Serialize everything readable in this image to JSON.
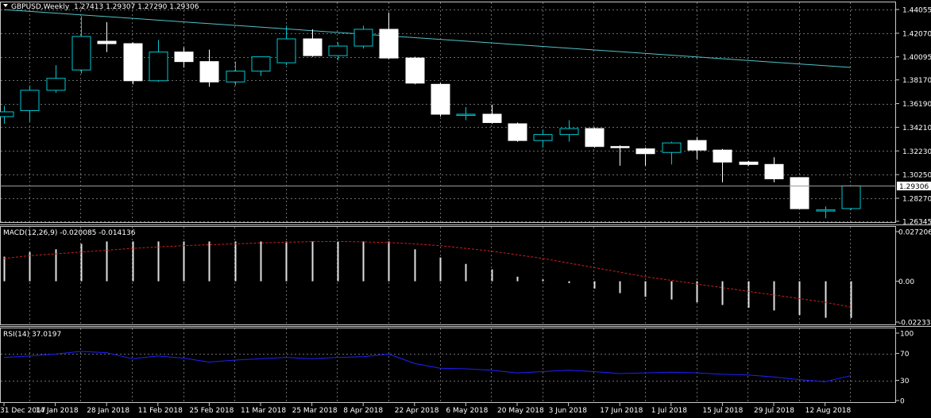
{
  "colors": {
    "background": "#000000",
    "bull_border": "#00c8d0",
    "bear_fill": "#ffffff",
    "trend": "#4fc3c8",
    "macd_signal": "#cc1f1f",
    "rsi": "#2020ff",
    "grid": "#6b6b6b",
    "text": "#ffffff",
    "tag_bg": "#ffffff",
    "tag_text": "#000000"
  },
  "price_panel": {
    "symbol": "GBPUSD,Weekly",
    "ohlc": "1.27413 1.29307 1.27290 1.29306",
    "current_price": "1.29306",
    "axis_labels": [
      "1.44055",
      "1.42070",
      "1.40095",
      "1.38170",
      "1.36190",
      "1.34210",
      "1.32230",
      "1.30250",
      "1.28270",
      "1.26345"
    ]
  },
  "macd_panel": {
    "label": "MACD(12,26,9) -0.020085 -0.014136",
    "axis_labels": [
      "0.027206",
      "0.00",
      "-0.022337"
    ]
  },
  "rsi_panel": {
    "label": "RSI(14) 37.0197",
    "axis_labels": [
      "100",
      "70",
      "30",
      "0"
    ]
  },
  "time_axis": [
    "31 Dec 2017",
    "14 Jan 2018",
    "28 Jan 2018",
    "11 Feb 2018",
    "25 Feb 2018",
    "11 Mar 2018",
    "25 Mar 2018",
    "8 Apr 2018",
    "22 Apr 2018",
    "6 May 2018",
    "20 May 2018",
    "3 Jun 2018",
    "17 Jun 2018",
    "1 Jul 2018",
    "15 Jul 2018",
    "29 Jul 2018",
    "12 Aug 2018"
  ],
  "chart_data": {
    "type": "candlestick",
    "title": "GBPUSD,Weekly",
    "ylim": [
      1.26345,
      1.44055
    ],
    "candles": [
      {
        "o": 1.351,
        "h": 1.36,
        "l": 1.345,
        "c": 1.355
      },
      {
        "o": 1.356,
        "h": 1.377,
        "l": 1.347,
        "c": 1.373
      },
      {
        "o": 1.373,
        "h": 1.394,
        "l": 1.371,
        "c": 1.383
      },
      {
        "o": 1.39,
        "h": 1.435,
        "l": 1.387,
        "c": 1.418
      },
      {
        "o": 1.414,
        "h": 1.43,
        "l": 1.405,
        "c": 1.412
      },
      {
        "o": 1.412,
        "h": 1.413,
        "l": 1.378,
        "c": 1.381
      },
      {
        "o": 1.381,
        "h": 1.415,
        "l": 1.38,
        "c": 1.405
      },
      {
        "o": 1.405,
        "h": 1.409,
        "l": 1.392,
        "c": 1.397
      },
      {
        "o": 1.397,
        "h": 1.407,
        "l": 1.376,
        "c": 1.38
      },
      {
        "o": 1.38,
        "h": 1.397,
        "l": 1.377,
        "c": 1.389
      },
      {
        "o": 1.389,
        "h": 1.4,
        "l": 1.385,
        "c": 1.401
      },
      {
        "o": 1.396,
        "h": 1.427,
        "l": 1.394,
        "c": 1.416
      },
      {
        "o": 1.416,
        "h": 1.424,
        "l": 1.401,
        "c": 1.402
      },
      {
        "o": 1.402,
        "h": 1.413,
        "l": 1.398,
        "c": 1.41
      },
      {
        "o": 1.41,
        "h": 1.427,
        "l": 1.408,
        "c": 1.424
      },
      {
        "o": 1.424,
        "h": 1.438,
        "l": 1.399,
        "c": 1.4
      },
      {
        "o": 1.4,
        "h": 1.401,
        "l": 1.378,
        "c": 1.379
      },
      {
        "o": 1.378,
        "h": 1.379,
        "l": 1.351,
        "c": 1.353
      },
      {
        "o": 1.353,
        "h": 1.359,
        "l": 1.348,
        "c": 1.353
      },
      {
        "o": 1.353,
        "h": 1.361,
        "l": 1.345,
        "c": 1.346
      },
      {
        "o": 1.345,
        "h": 1.346,
        "l": 1.33,
        "c": 1.331
      },
      {
        "o": 1.331,
        "h": 1.34,
        "l": 1.325,
        "c": 1.336
      },
      {
        "o": 1.336,
        "h": 1.348,
        "l": 1.33,
        "c": 1.341
      },
      {
        "o": 1.341,
        "h": 1.342,
        "l": 1.325,
        "c": 1.326
      },
      {
        "o": 1.326,
        "h": 1.327,
        "l": 1.31,
        "c": 1.325
      },
      {
        "o": 1.324,
        "h": 1.325,
        "l": 1.31,
        "c": 1.32
      },
      {
        "o": 1.321,
        "h": 1.33,
        "l": 1.311,
        "c": 1.329
      },
      {
        "o": 1.331,
        "h": 1.334,
        "l": 1.315,
        "c": 1.323
      },
      {
        "o": 1.323,
        "h": 1.324,
        "l": 1.296,
        "c": 1.313
      },
      {
        "o": 1.313,
        "h": 1.314,
        "l": 1.31,
        "c": 1.311
      },
      {
        "o": 1.311,
        "h": 1.317,
        "l": 1.296,
        "c": 1.299
      },
      {
        "o": 1.3,
        "h": 1.3,
        "l": 1.274,
        "c": 1.274
      },
      {
        "o": 1.272,
        "h": 1.276,
        "l": 1.266,
        "c": 1.273
      },
      {
        "o": 1.2741,
        "h": 1.2931,
        "l": 1.2729,
        "c": 1.2931
      }
    ],
    "trendline": [
      {
        "x": 0,
        "y": 1.4405
      },
      {
        "x": 33,
        "y": 1.3921
      }
    ],
    "macd_hist": [
      0.0135,
      0.016,
      0.0175,
      0.0205,
      0.0218,
      0.0218,
      0.0218,
      0.0218,
      0.0218,
      0.0218,
      0.0218,
      0.0218,
      0.0218,
      0.0218,
      0.0218,
      0.0218,
      0.0175,
      0.013,
      0.0095,
      0.0065,
      0.0025,
      0.001,
      -0.001,
      -0.004,
      -0.0065,
      -0.0085,
      -0.01,
      -0.0115,
      -0.013,
      -0.0145,
      -0.016,
      -0.0185,
      -0.02,
      -0.0201
    ],
    "macd_signal": [
      0.0125,
      0.014,
      0.015,
      0.016,
      0.017,
      0.018,
      0.0188,
      0.0195,
      0.02,
      0.0205,
      0.021,
      0.0214,
      0.0217,
      0.0218,
      0.0216,
      0.0212,
      0.0205,
      0.0195,
      0.018,
      0.0165,
      0.0145,
      0.0125,
      0.01,
      0.0075,
      0.005,
      0.0025,
      0.0005,
      -0.0015,
      -0.0035,
      -0.0055,
      -0.0075,
      -0.0095,
      -0.0115,
      -0.0141
    ],
    "rsi": [
      64,
      66,
      69,
      73,
      71,
      62,
      66,
      63,
      57,
      60,
      62,
      64,
      62,
      64,
      65,
      69,
      55,
      48,
      47,
      45,
      41,
      43,
      45,
      43,
      40,
      41,
      42,
      41,
      39,
      38,
      35,
      31,
      28,
      37
    ]
  }
}
